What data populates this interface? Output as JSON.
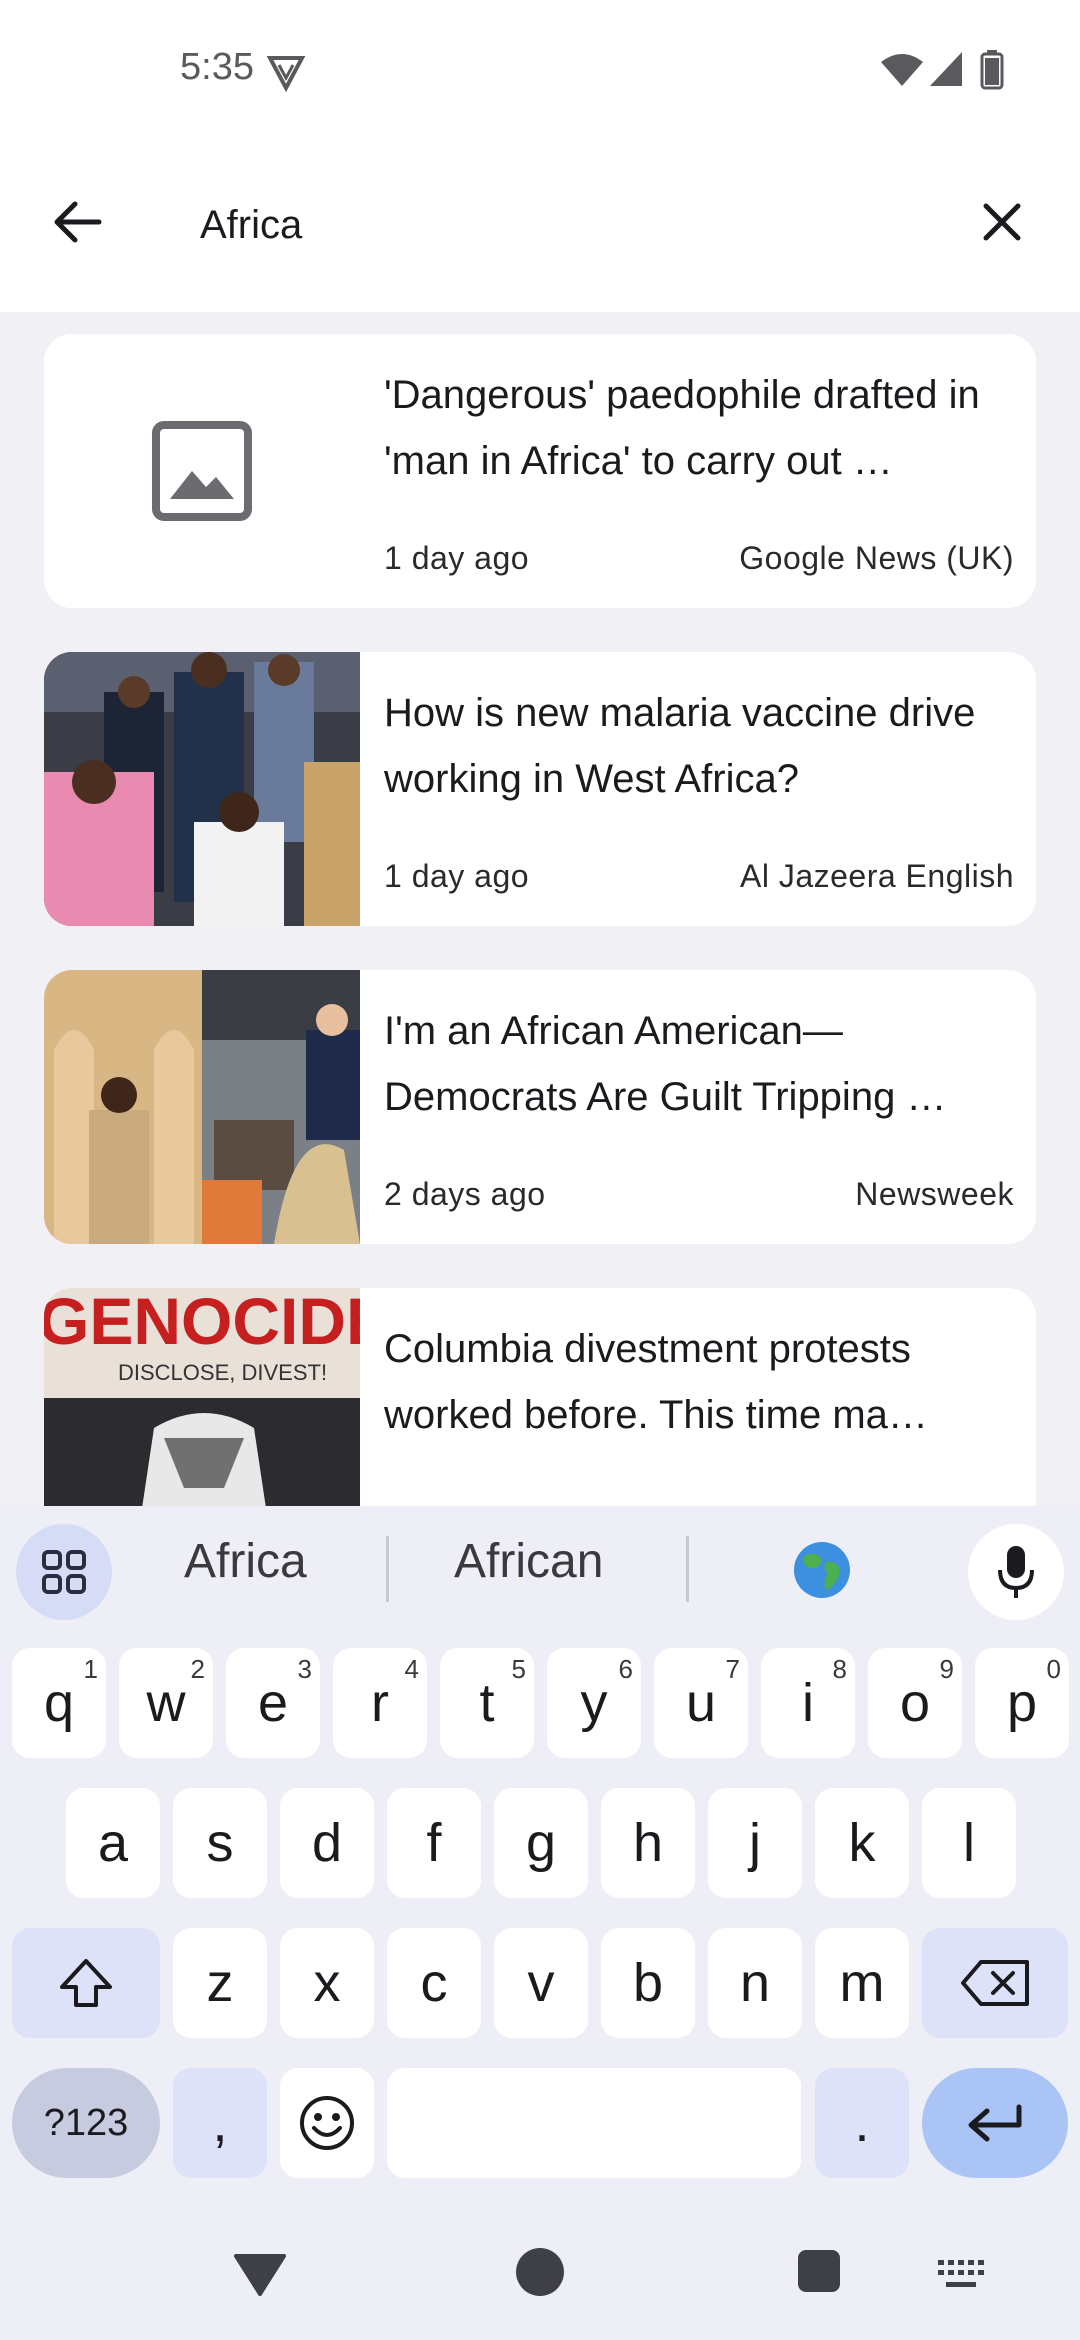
{
  "status_bar": {
    "time": "5:35"
  },
  "search": {
    "query": "Africa"
  },
  "results": [
    {
      "headline": "'Dangerous' paedophile drafted in 'man in Africa' to carry out …",
      "time": "1 day ago",
      "source": "Google News (UK)",
      "thumbnail": "placeholder-image-icon"
    },
    {
      "headline": "How is new malaria vaccine drive working in West Africa?",
      "time": "1 day ago",
      "source": "Al Jazeera English",
      "thumbnail": "photo"
    },
    {
      "headline": "I'm an African American—Democrats Are Guilt Tripping …",
      "time": "2 days ago",
      "source": "Newsweek",
      "thumbnail": "photo"
    },
    {
      "headline": "Columbia divestment protests worked before. This time ma…",
      "time": "",
      "source": "",
      "thumbnail": "photo"
    }
  ],
  "thumb_texts": {
    "protest_sign": "GENOCIDE",
    "protest_sub": "DISCLOSE, DIVEST!"
  },
  "keyboard": {
    "suggestions": [
      "Africa",
      "African"
    ],
    "row1": [
      {
        "key": "q",
        "hint": "1"
      },
      {
        "key": "w",
        "hint": "2"
      },
      {
        "key": "e",
        "hint": "3"
      },
      {
        "key": "r",
        "hint": "4"
      },
      {
        "key": "t",
        "hint": "5"
      },
      {
        "key": "y",
        "hint": "6"
      },
      {
        "key": "u",
        "hint": "7"
      },
      {
        "key": "i",
        "hint": "8"
      },
      {
        "key": "o",
        "hint": "9"
      },
      {
        "key": "p",
        "hint": "0"
      }
    ],
    "row2": [
      "a",
      "s",
      "d",
      "f",
      "g",
      "h",
      "j",
      "k",
      "l"
    ],
    "row3": [
      "z",
      "x",
      "c",
      "v",
      "b",
      "n",
      "m"
    ],
    "symbols_label": "?123",
    "comma": ",",
    "period": "."
  },
  "colors": {
    "list_bg": "#f0f0f5",
    "keyboard_bg": "#eeeff6",
    "enter_key": "#a9c4f5",
    "func_key": "#dde2f8"
  }
}
